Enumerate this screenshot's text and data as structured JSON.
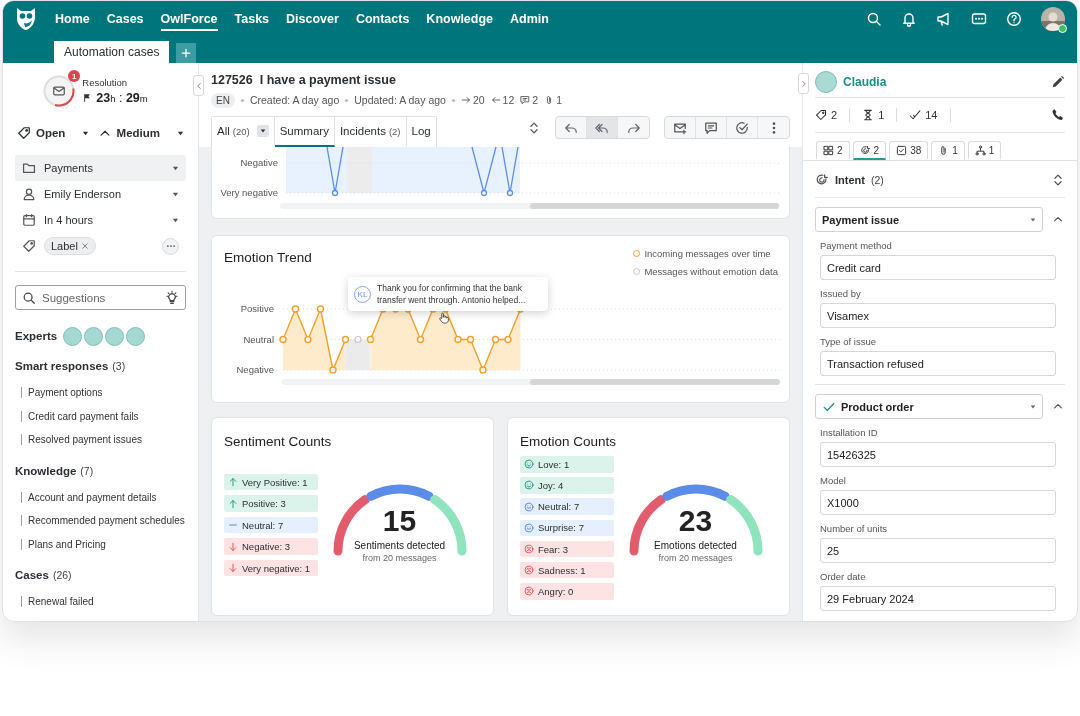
{
  "nav": {
    "items": [
      {
        "label": "Home",
        "selected": false
      },
      {
        "label": "Cases",
        "selected": false
      },
      {
        "label": "OwlForce",
        "selected": true
      },
      {
        "label": "Tasks",
        "selected": false
      },
      {
        "label": "Discover",
        "selected": false
      },
      {
        "label": "Contacts",
        "selected": false
      },
      {
        "label": "Knowledge",
        "selected": false
      },
      {
        "label": "Admin",
        "selected": false
      }
    ]
  },
  "tabs": [
    {
      "label": "Automation cases",
      "selected": true
    }
  ],
  "case_sidebar": {
    "resolution": {
      "label": "Resolution",
      "badge": "1",
      "level": 0.32,
      "hours": "23",
      "hours_unit": "h",
      "separator": ":",
      "minutes": "29",
      "minutes_unit": "m"
    },
    "status": "Open",
    "priority": "Medium",
    "properties": [
      {
        "kind": "folder",
        "value": "Payments",
        "selected": true
      },
      {
        "kind": "person",
        "value": "Emily Enderson",
        "selected": false
      },
      {
        "kind": "calendar",
        "value": "In 4 hours",
        "selected": false
      }
    ],
    "labels": [
      "Label"
    ],
    "search": {
      "placeholder": "Suggestions"
    },
    "experts": {
      "title": "Experts",
      "avatars": [
        {
          "kind": "avatar"
        },
        {
          "kind": "avatar"
        },
        {
          "kind": "avatar"
        },
        {
          "kind": "avatar"
        }
      ]
    },
    "sections": [
      {
        "title": "Smart responses",
        "count": "(3)",
        "items": [
          "Payment options",
          "Credit card payment fails",
          "Resolved payment issues"
        ]
      },
      {
        "title": "Knowledge",
        "count": "(7)",
        "items": [
          "Account and payment details",
          "Recommended payment schedules",
          "Plans and Pricing"
        ]
      },
      {
        "title": "Cases",
        "count": "(26)",
        "items": [
          "Renewal failed"
        ]
      }
    ]
  },
  "case": {
    "id": "127526",
    "title": "I have a payment issue",
    "language": "EN",
    "created": "Created: A day ago",
    "updated": "Updated: A day ago",
    "outgoing": "20",
    "incoming": "12",
    "comments": "2",
    "attachments": "1",
    "tabs": [
      {
        "label": "All",
        "count": "(20)",
        "kind": "dropdown",
        "selected": false
      },
      {
        "label": "Summary",
        "kind": "plain",
        "selected": true
      },
      {
        "label": "Incidents",
        "count": "(2)",
        "kind": "plain",
        "selected": false
      },
      {
        "label": "Log",
        "kind": "plain",
        "selected": false
      }
    ],
    "reply_actions": [
      {
        "kind": "reply",
        "selected": false
      },
      {
        "kind": "reply-all",
        "selected": true
      },
      {
        "kind": "forward",
        "selected": false
      }
    ],
    "actions": [
      {
        "kind": "new-mail"
      },
      {
        "kind": "comment"
      },
      {
        "kind": "done"
      },
      {
        "kind": "more"
      }
    ]
  },
  "sentiment_trend": {
    "y_labels": [
      "Negative",
      "Very negative"
    ]
  },
  "emotion_trend": {
    "title": "Emotion Trend",
    "legend": [
      {
        "kind": "data",
        "label": "Incoming messages over time"
      },
      {
        "kind": "no-data",
        "label": "Messages without emotion data"
      }
    ],
    "y_labels": [
      "Positive",
      "Neutral",
      "Negative"
    ],
    "tooltip": {
      "initials": "KL",
      "text": "Thank you for confirming that the bank transfer went through. Antonio helped..."
    }
  },
  "sentiment_counts": {
    "title": "Sentiment Counts",
    "items": [
      {
        "kind": "up",
        "label": "Very Positive: 1"
      },
      {
        "kind": "up",
        "label": "Positive: 3"
      },
      {
        "kind": "flat",
        "label": "Neutral: 7"
      },
      {
        "kind": "down",
        "label": "Negative: 3"
      },
      {
        "kind": "down",
        "label": "Very negative: 1"
      }
    ],
    "total": "15",
    "caption": "Sentiments detected",
    "subcaption": "from 20 messages"
  },
  "emotion_counts": {
    "title": "Emotion Counts",
    "items": [
      {
        "kind": "happy",
        "label": "Love: 1"
      },
      {
        "kind": "happy",
        "label": "Joy: 4"
      },
      {
        "kind": "neutral",
        "label": "Neutral: 7"
      },
      {
        "kind": "neutral",
        "label": "Surprise: 7"
      },
      {
        "kind": "sad",
        "label": "Fear: 3"
      },
      {
        "kind": "sad",
        "label": "Sadness: 1"
      },
      {
        "kind": "sad",
        "label": "Angry: 0"
      }
    ],
    "total": "23",
    "caption": "Emotions detected",
    "subcaption": "from 20 messages"
  },
  "contact": {
    "name": "Claudia",
    "tags": "2",
    "pending": "1",
    "done": "14"
  },
  "detail_tabs": [
    {
      "kind": "grid",
      "count": "2",
      "selected": false
    },
    {
      "kind": "intent",
      "count": "2",
      "selected": true
    },
    {
      "kind": "task",
      "count": "38",
      "selected": false
    },
    {
      "kind": "attachment",
      "count": "1",
      "selected": false
    },
    {
      "kind": "hierarchy",
      "count": "1",
      "selected": false
    }
  ],
  "intent": {
    "title": "Intent",
    "count": "(2)",
    "groups": [
      {
        "name": "Payment issue",
        "checked": false,
        "expanded": true,
        "fields": [
          {
            "label": "Payment method",
            "value": "Credit card"
          },
          {
            "label": "Issued by",
            "value": "Visamex"
          },
          {
            "label": "Type of issue",
            "value": "Transaction refused"
          }
        ]
      },
      {
        "name": "Product order",
        "checked": true,
        "expanded": true,
        "fields": [
          {
            "label": "Installation ID",
            "value": "15426325"
          },
          {
            "label": "Model",
            "value": "X1000"
          },
          {
            "label": "Number of units",
            "value": "25"
          },
          {
            "label": "Order date",
            "value": "29 February 2024"
          }
        ]
      }
    ]
  }
}
